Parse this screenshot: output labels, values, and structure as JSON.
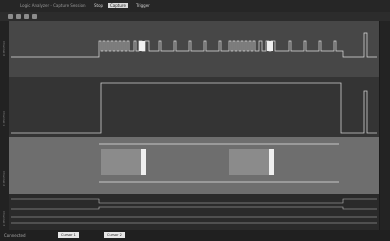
{
  "window": {
    "title": "Logic Analyzer - Capture Session",
    "menu": [
      "Stop",
      "Capture",
      "Trigger"
    ]
  },
  "toolbar": {
    "buttons": [
      "play-icon",
      "pause-icon",
      "zoom-in-icon",
      "zoom-out-icon"
    ]
  },
  "tracks": [
    {
      "label": "Channel 0"
    },
    {
      "label": "Channel 1"
    },
    {
      "label": "Channel 2"
    },
    {
      "label": "Channel 3"
    }
  ],
  "status": {
    "left_text": "Connected",
    "button_1": "Cursor 1",
    "button_2": "Cursor 2"
  },
  "colors": {
    "background": "#1b1b1b",
    "track_1": "#474747",
    "track_2": "#343434",
    "track_3": "#6e6e6e",
    "signal": "#e0e0e0"
  }
}
